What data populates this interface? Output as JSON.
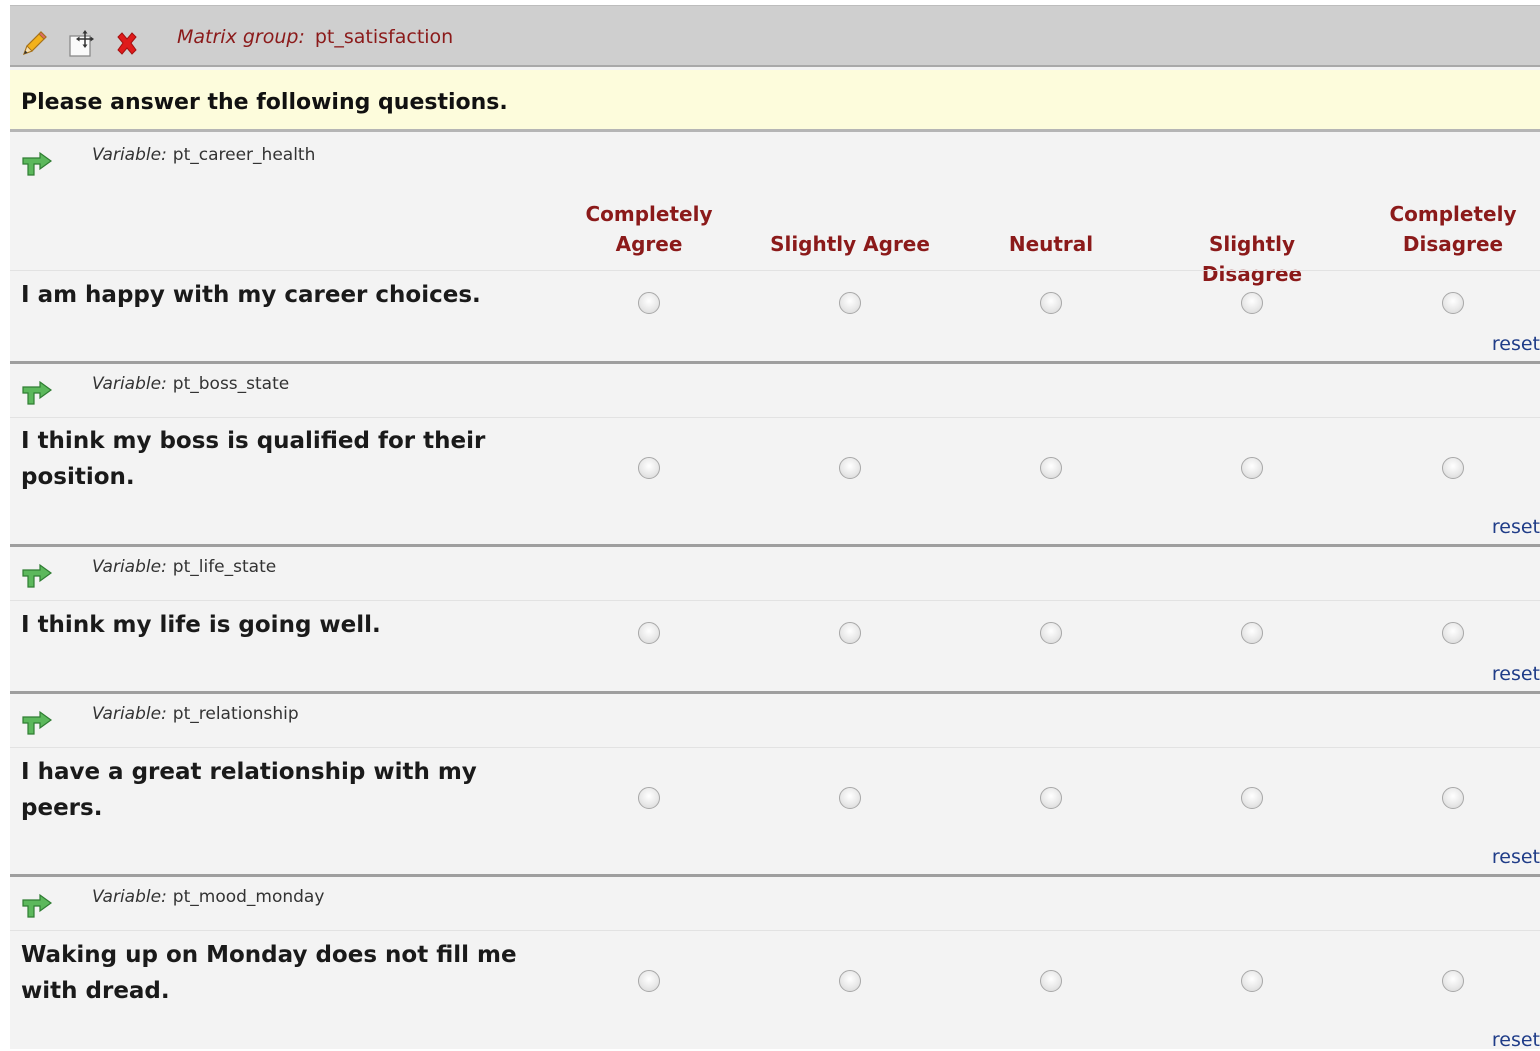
{
  "toolbar": {
    "icons": [
      "pencil-icon",
      "move-icon",
      "delete-icon"
    ],
    "matrix_group_prefix": "Matrix group:",
    "matrix_group_name": "pt_satisfaction"
  },
  "instructions": "Please answer the following questions.",
  "columns": [
    "Completely Agree",
    "Slightly Agree",
    "Neutral",
    "Slightly Disagree",
    "Completely Disagree"
  ],
  "column_headers": [
    {
      "line1": "Completely",
      "line2": "Agree"
    },
    {
      "line1": "",
      "line2": "Slightly Agree"
    },
    {
      "line1": "",
      "line2": "Neutral"
    },
    {
      "line1": "",
      "line2": "Slightly Disagree"
    },
    {
      "line1": "Completely",
      "line2": "Disagree"
    }
  ],
  "variable_prefix": "Variable:",
  "reset_label": "reset",
  "questions": [
    {
      "variable": "pt_career_health",
      "text_lines": [
        "I am happy with my career choices."
      ],
      "selected": null
    },
    {
      "variable": "pt_boss_state",
      "text_lines": [
        "I think my boss is qualified for their",
        "position."
      ],
      "selected": null
    },
    {
      "variable": "pt_life_state",
      "text_lines": [
        "I think my life is going well."
      ],
      "selected": null
    },
    {
      "variable": "pt_relationship",
      "text_lines": [
        "I have a great relationship with my",
        "peers."
      ],
      "selected": null
    },
    {
      "variable": "pt_mood_monday",
      "text_lines": [
        "Waking up on Monday does not fill me",
        "with dread."
      ],
      "selected": null
    }
  ],
  "colors": {
    "toolbar_bg": "#cfcfcf",
    "banner_bg": "#fdfcdc",
    "header_text": "#8b1a1a",
    "reset_link": "#1f3c88",
    "branch_icon": "#4caf50",
    "delete_icon": "#e01b1b",
    "pencil_icon": "#f0a500"
  }
}
